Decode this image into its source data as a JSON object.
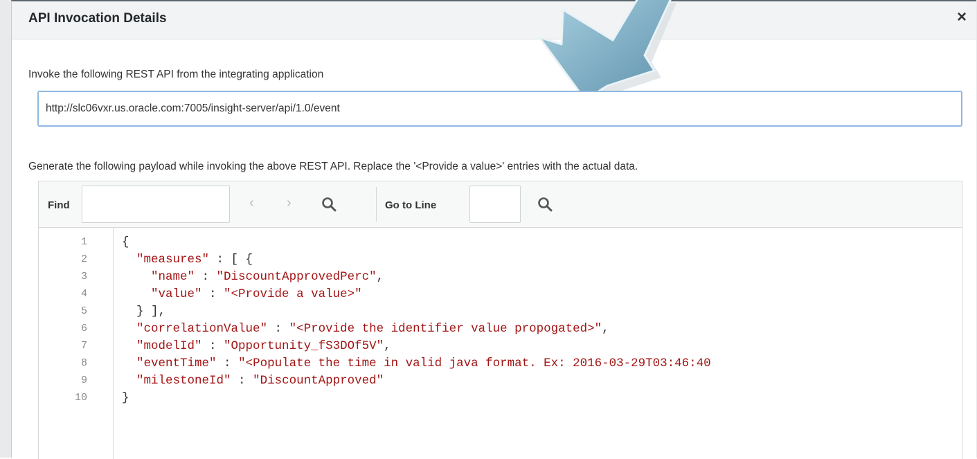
{
  "dialog": {
    "title": "API Invocation Details",
    "close_icon": "×"
  },
  "invoke": {
    "instruction": "Invoke the following REST API from the integrating application",
    "url": "http://slc06vxr.us.oracle.com:7005/insight-server/api/1.0/event"
  },
  "payload": {
    "instruction": "Generate the following payload while invoking the above REST API. Replace the '<Provide a value>' entries with the actual data."
  },
  "editor": {
    "find_label": "Find",
    "find_value": "",
    "prev_icon": "‹",
    "next_icon": "›",
    "goto_label": "Go to Line",
    "goto_value": "",
    "line_numbers": [
      "1",
      "2",
      "3",
      "4",
      "5",
      "6",
      "7",
      "8",
      "9",
      "10"
    ],
    "code": {
      "l1_brace": "{",
      "l2_key": "\"measures\"",
      "l2_rest": " : [ {",
      "l3_key": "\"name\"",
      "l3_sep": " : ",
      "l3_val": "\"DiscountApprovedPerc\"",
      "l3_end": ",",
      "l4_key": "\"value\"",
      "l4_sep": " : ",
      "l4_val": "\"<Provide a value>\"",
      "l5": "} ],",
      "l6_key": "\"correlationValue\"",
      "l6_sep": " : ",
      "l6_val": "\"<Provide the identifier value propogated>\"",
      "l6_end": ",",
      "l7_key": "\"modelId\"",
      "l7_sep": " : ",
      "l7_val": "\"Opportunity_fS3DOf5V\"",
      "l7_end": ",",
      "l8_key": "\"eventTime\"",
      "l8_sep": " : ",
      "l8_val": "\"<Populate the time in valid java format. Ex: 2016-03-29T03:46:40",
      "l9_key": "\"milestoneId\"",
      "l9_sep": " : ",
      "l9_val": "\"DiscountApproved\"",
      "l10_brace": "}"
    }
  },
  "colors": {
    "string": "#a31515",
    "focus_border": "#8fb8e2",
    "arrow": "#7fafc4"
  },
  "icons": [
    "close-icon",
    "search-icon",
    "chevron-left-icon",
    "chevron-right-icon",
    "arrow-pointer-icon"
  ]
}
